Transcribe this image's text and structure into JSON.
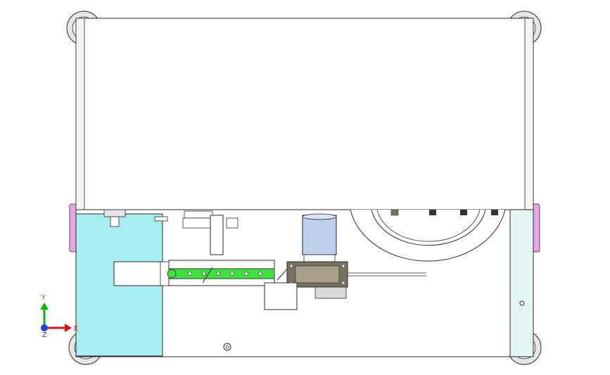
{
  "viewport": {
    "background": "#ffffff",
    "triad": {
      "y_label": "Y",
      "x_label": "X",
      "z_label": "Z",
      "x_color": "#e01010",
      "y_color": "#10b010",
      "z_color": "#2040e0"
    }
  },
  "colors": {
    "outline": "#2a2a2a",
    "panel_fill": "#ffffff",
    "column_fill": "#f4f4f0",
    "cyan_block": "#a6eef0",
    "cyan_right": "#e4f6f4",
    "caster": "#e6e6e6",
    "bracket": "#e8a6e8",
    "green": "#3fe03f",
    "motor": "#c0d0ec",
    "dark_block": "#7a7060",
    "gray_block": "#d8d8d8"
  },
  "icons": [
    "gear-icon",
    "casters",
    "motor-cylinder",
    "rotary-disc",
    "triad-icon"
  ]
}
